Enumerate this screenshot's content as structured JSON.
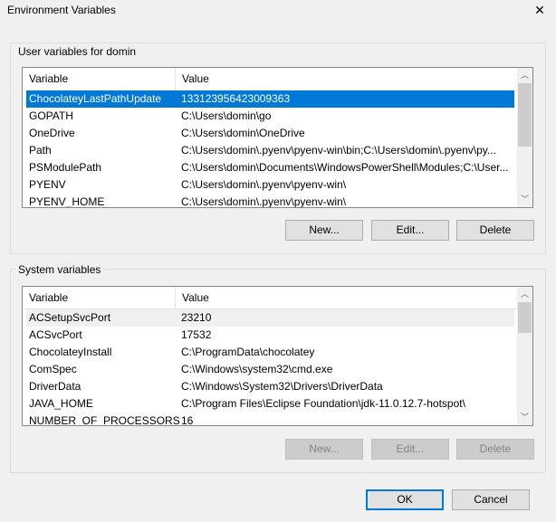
{
  "window": {
    "title": "Environment Variables",
    "close_icon": "close-icon"
  },
  "user": {
    "label": "User variables for domin",
    "col_variable": "Variable",
    "col_value": "Value",
    "rows": [
      {
        "name": "ChocolateyLastPathUpdate",
        "value": "133123956423009363"
      },
      {
        "name": "GOPATH",
        "value": "C:\\Users\\domin\\go"
      },
      {
        "name": "OneDrive",
        "value": "C:\\Users\\domin\\OneDrive"
      },
      {
        "name": "Path",
        "value": "C:\\Users\\domin\\.pyenv\\pyenv-win\\bin;C:\\Users\\domin\\.pyenv\\py..."
      },
      {
        "name": "PSModulePath",
        "value": "C:\\Users\\domin\\Documents\\WindowsPowerShell\\Modules;C:\\User..."
      },
      {
        "name": "PYENV",
        "value": "C:\\Users\\domin\\.pyenv\\pyenv-win\\"
      },
      {
        "name": "PYENV_HOME",
        "value": "C:\\Users\\domin\\.pyenv\\pyenv-win\\"
      }
    ],
    "new": "New...",
    "edit": "Edit...",
    "delete": "Delete"
  },
  "system": {
    "label": "System variables",
    "col_variable": "Variable",
    "col_value": "Value",
    "rows": [
      {
        "name": "ACSetupSvcPort",
        "value": "23210"
      },
      {
        "name": "ACSvcPort",
        "value": "17532"
      },
      {
        "name": "ChocolateyInstall",
        "value": "C:\\ProgramData\\chocolatey"
      },
      {
        "name": "ComSpec",
        "value": "C:\\Windows\\system32\\cmd.exe"
      },
      {
        "name": "DriverData",
        "value": "C:\\Windows\\System32\\Drivers\\DriverData"
      },
      {
        "name": "JAVA_HOME",
        "value": "C:\\Program Files\\Eclipse Foundation\\jdk-11.0.12.7-hotspot\\"
      },
      {
        "name": "NUMBER_OF_PROCESSORS",
        "value": "16"
      }
    ],
    "new": "New...",
    "edit": "Edit...",
    "delete": "Delete"
  },
  "ok": "OK",
  "cancel": "Cancel",
  "colors": {
    "selection": "#0078d7",
    "background": "#f0f0f0"
  }
}
